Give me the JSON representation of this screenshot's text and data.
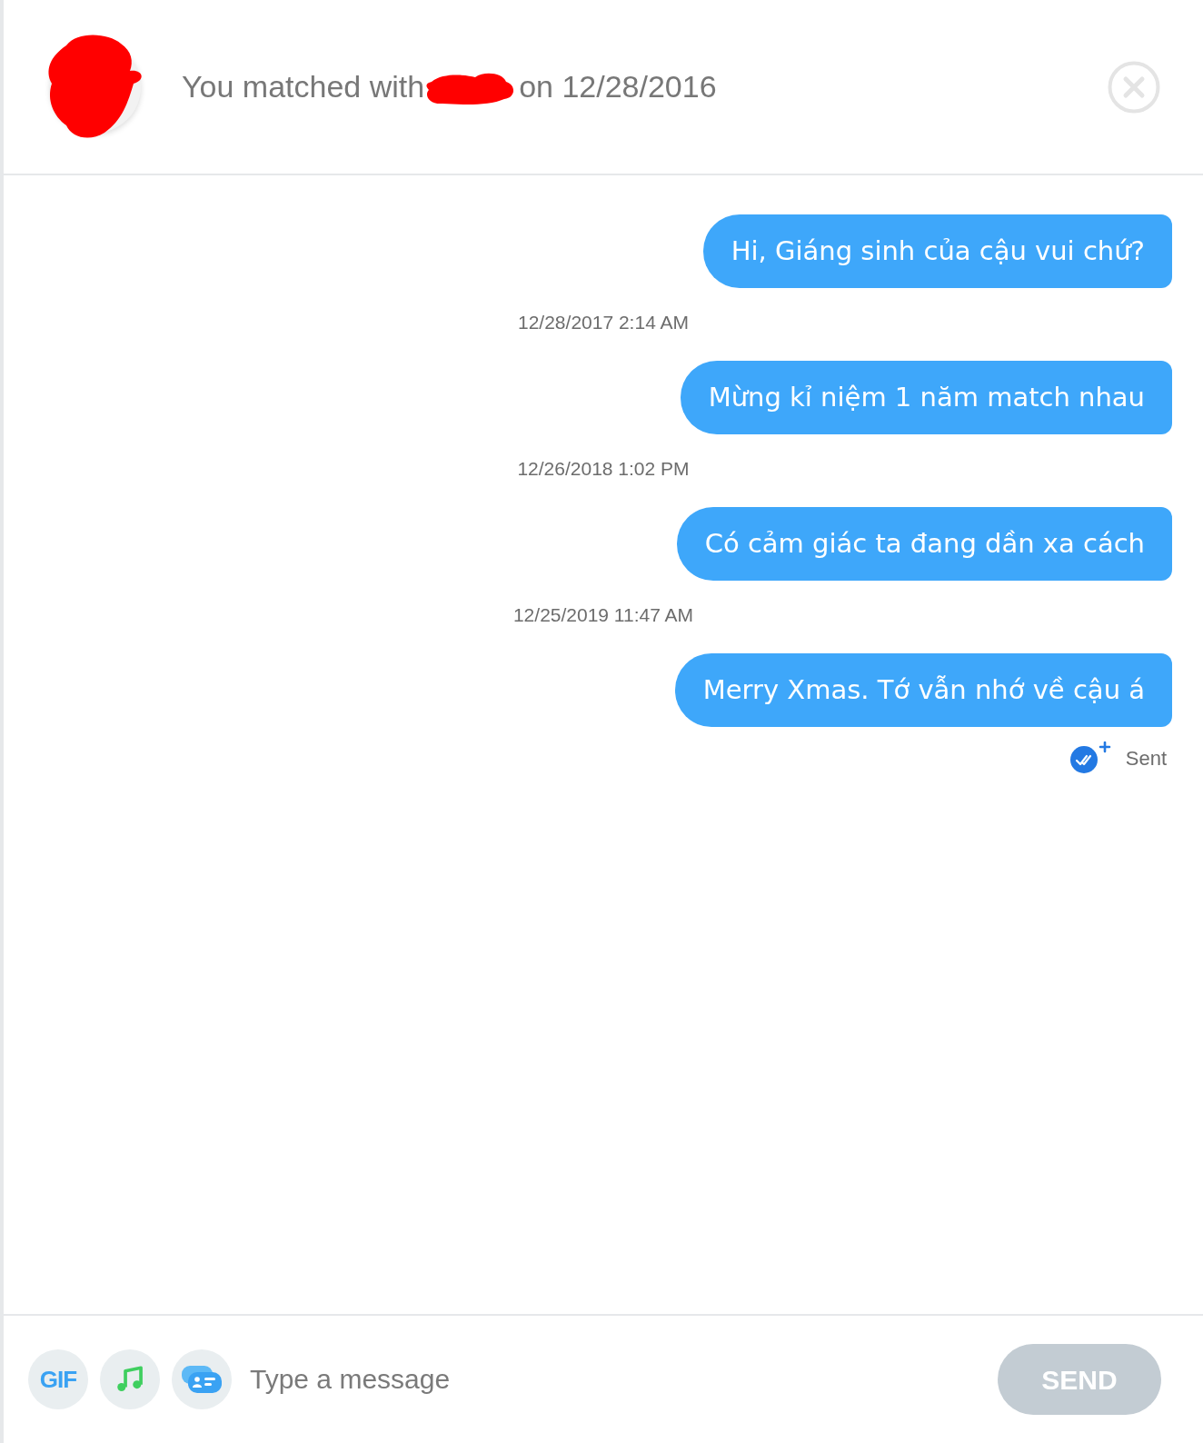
{
  "header": {
    "avatar": {
      "redacted": true
    },
    "match_text": {
      "before": "You matched with",
      "name_redacted": true,
      "after": "on 12/28/2016"
    }
  },
  "thread": [
    {
      "kind": "message",
      "text": "Hi, Giáng sinh của cậu vui chứ?"
    },
    {
      "kind": "timestamp",
      "text": "12/28/2017 2:14 AM"
    },
    {
      "kind": "message",
      "text": "Mừng kỉ niệm 1 năm match nhau"
    },
    {
      "kind": "timestamp",
      "text": "12/26/2018 1:02 PM"
    },
    {
      "kind": "message",
      "text": "Có cảm giác ta đang dần xa cách"
    },
    {
      "kind": "timestamp",
      "text": "12/25/2019 11:47 AM"
    },
    {
      "kind": "message",
      "text": "Merry Xmas. Tớ vẫn nhớ về cậu á"
    }
  ],
  "status": {
    "text": "Sent"
  },
  "composer": {
    "buttons": [
      {
        "kind": "gif",
        "label": "GIF"
      },
      {
        "kind": "music"
      },
      {
        "kind": "card"
      }
    ],
    "placeholder": "Type a message",
    "send": {
      "label": "SEND",
      "disabled": true
    }
  }
}
